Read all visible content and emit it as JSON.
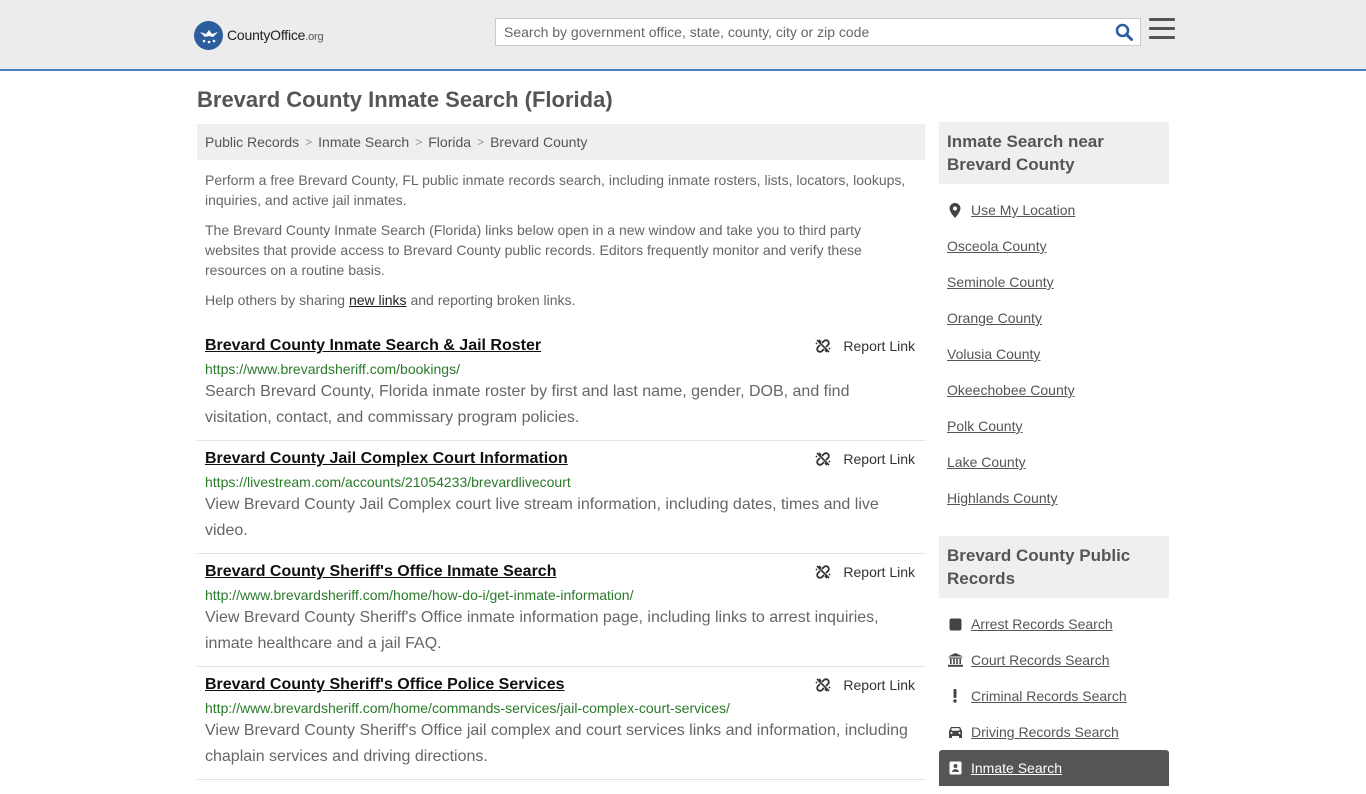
{
  "header": {
    "logo_text_main": "CountyOffice",
    "logo_text_suffix": ".org",
    "search_placeholder": "Search by government office, state, county, city or zip code"
  },
  "page_title": "Brevard County Inmate Search (Florida)",
  "breadcrumb": [
    "Public Records",
    "Inmate Search",
    "Florida",
    "Brevard County"
  ],
  "intro": {
    "p1": "Perform a free Brevard County, FL public inmate records search, including inmate rosters, lists, locators, lookups, inquiries, and active jail inmates.",
    "p2": "The Brevard County Inmate Search (Florida) links below open in a new window and take you to third party websites that provide access to Brevard County public records. Editors frequently monitor and verify these resources on a routine basis.",
    "p3_before": "Help others by sharing ",
    "p3_link": "new links",
    "p3_after": " and reporting broken links."
  },
  "report_label": "Report Link",
  "results": [
    {
      "title": "Brevard County Inmate Search & Jail Roster",
      "url": "https://www.brevardsheriff.com/bookings/",
      "desc": "Search Brevard County, Florida inmate roster by first and last name, gender, DOB, and find visitation, contact, and commissary program policies."
    },
    {
      "title": "Brevard County Jail Complex Court Information",
      "url": "https://livestream.com/accounts/21054233/brevardlivecourt",
      "desc": "View Brevard County Jail Complex court live stream information, including dates, times and live video."
    },
    {
      "title": "Brevard County Sheriff's Office Inmate Search",
      "url": "http://www.brevardsheriff.com/home/how-do-i/get-inmate-information/",
      "desc": "View Brevard County Sheriff's Office inmate information page, including links to arrest inquiries, inmate healthcare and a jail FAQ."
    },
    {
      "title": "Brevard County Sheriff's Office Police Services",
      "url": "http://www.brevardsheriff.com/home/commands-services/jail-complex-court-services/",
      "desc": "View Brevard County Sheriff's Office jail complex and court services links and information, including chaplain services and driving directions."
    }
  ],
  "sidebar": {
    "nearby_title": "Inmate Search near Brevard County",
    "use_location": "Use My Location",
    "nearby": [
      "Osceola County",
      "Seminole County",
      "Orange County",
      "Volusia County",
      "Okeechobee County",
      "Polk County",
      "Lake County",
      "Highlands County"
    ],
    "records_title": "Brevard County Public Records",
    "records": [
      {
        "label": "Arrest Records Search",
        "icon": "square-icon"
      },
      {
        "label": "Court Records Search",
        "icon": "courthouse-icon"
      },
      {
        "label": "Criminal Records Search",
        "icon": "exclamation-icon"
      },
      {
        "label": "Driving Records Search",
        "icon": "car-icon"
      },
      {
        "label": "Inmate Search",
        "icon": "inmate-icon"
      }
    ]
  },
  "colors": {
    "accent": "#4a7fc0",
    "link_green": "#2a7a2a",
    "active_bg": "#555555"
  }
}
